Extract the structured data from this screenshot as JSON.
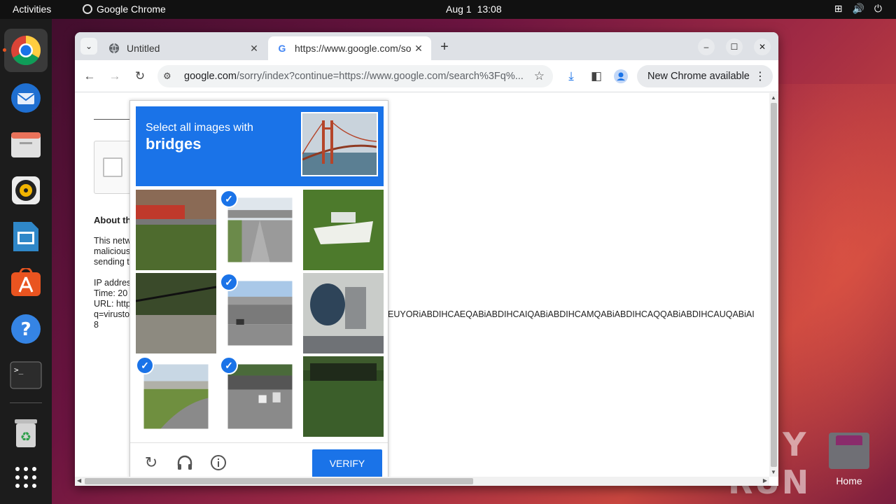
{
  "topbar": {
    "activities": "Activities",
    "app_name": "Google Chrome",
    "date": "Aug 1",
    "time": "13:08"
  },
  "dock": {
    "items": [
      "chrome",
      "thunderbird",
      "files",
      "rhythmbox",
      "libreoffice-impress",
      "app-center",
      "help",
      "terminal",
      "trash",
      "show-apps"
    ]
  },
  "browser": {
    "tabs": [
      {
        "title": "Untitled",
        "active": false
      },
      {
        "title": "https://www.google.com/sorry/index?continue=https://www.google.com/search",
        "active": true
      }
    ],
    "url_host": "google.com",
    "url_path": "/sorry/index?continue=https://www.google.com/search%3Fq%...",
    "new_chrome": "New Chrome available"
  },
  "page": {
    "about": "About th",
    "para_lines": [
      "This netw",
      "malicious",
      "sending t"
    ],
    "ip_lines": [
      "IP addres",
      "Time: 20",
      "URL: http",
      "q=virusto",
      "8"
    ],
    "long_tail": "EUYORiABDIHCAEQABiABDIHCAIQABiABDIHCAMQABiABDIHCAQQABiABDIHCAUQABiAI"
  },
  "captcha": {
    "line1": "Select all images with",
    "line2": "bridges",
    "tiles": [
      {
        "name": "tile-bus-street",
        "selected": false
      },
      {
        "name": "tile-overpass-road",
        "selected": true
      },
      {
        "name": "tile-boat-grass",
        "selected": false
      },
      {
        "name": "tile-stone-wall",
        "selected": false
      },
      {
        "name": "tile-overpass-highway",
        "selected": true
      },
      {
        "name": "tile-tank-industrial",
        "selected": false
      },
      {
        "name": "tile-bridge-curve",
        "selected": true
      },
      {
        "name": "tile-tunnel-traffic",
        "selected": true
      },
      {
        "name": "tile-hedge-fence",
        "selected": false
      }
    ],
    "verify": "VERIFY"
  },
  "desktop": {
    "home_label": "Home",
    "watermark": "ANY RUN"
  },
  "colors": {
    "captcha_blue": "#1a73e8",
    "ubuntu_orange": "#e95420",
    "topbar": "#111111"
  }
}
